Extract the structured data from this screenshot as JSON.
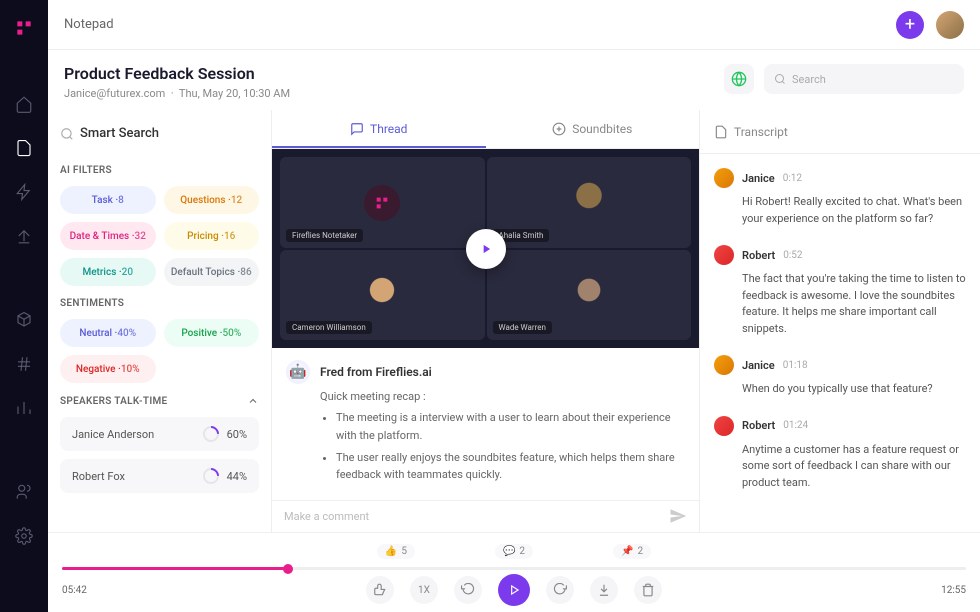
{
  "topbar": {
    "title": "Notepad"
  },
  "header": {
    "title": "Product Feedback Session",
    "email": "Janice@futurex.com",
    "date": "Thu, May 20, 10:30 AM",
    "search_placeholder": "Search"
  },
  "sidebar": {
    "smart_search": "Smart Search",
    "filters_label": "AI FILTERS",
    "filters": [
      [
        {
          "label": "Task",
          "count": 8,
          "cls": "p-blue"
        },
        {
          "label": "Questions",
          "count": 12,
          "cls": "p-orange"
        }
      ],
      [
        {
          "label": "Date & Times",
          "count": 32,
          "cls": "p-pink"
        },
        {
          "label": "Pricing",
          "count": 16,
          "cls": "p-yellow"
        }
      ],
      [
        {
          "label": "Metrics",
          "count": 20,
          "cls": "p-teal"
        },
        {
          "label": "Default Topics",
          "count": 86,
          "cls": "p-gray"
        }
      ]
    ],
    "sentiments_label": "SENTIMENTS",
    "sentiments": [
      [
        {
          "label": "Neutral",
          "count": "40%",
          "cls": "p-blue"
        },
        {
          "label": "Positive",
          "count": "50%",
          "cls": "p-green"
        }
      ],
      [
        {
          "label": "Negative",
          "count": "10%",
          "cls": "p-red"
        }
      ]
    ],
    "speakers_label": "SPEAKERS TALK-TIME",
    "speakers": [
      {
        "name": "Janice Anderson",
        "pct": "60%"
      },
      {
        "name": "Robert Fox",
        "pct": "44%"
      }
    ]
  },
  "tabs": {
    "thread": "Thread",
    "soundbites": "Soundbites"
  },
  "video_tiles": [
    "Fireflies Notetaker",
    "Ahalia Smith",
    "Cameron Williamson",
    "Wade Warren"
  ],
  "recap": {
    "author": "Fred from Fireflies.ai",
    "subtitle": "Quick meeting recap :",
    "bullets": [
      "The meeting is a interview with a user to learn about their experience with the platform.",
      "The user really enjoys the soundbites feature, which helps them share feedback with teammates quickly."
    ]
  },
  "comment_placeholder": "Make a comment",
  "transcript": {
    "label": "Transcript",
    "msgs": [
      {
        "name": "Janice",
        "time": "0:12",
        "text": "Hi Robert! Really excited to chat. What's been your experience on the platform so far?",
        "av": "av-j"
      },
      {
        "name": "Robert",
        "time": "0:52",
        "text": "The fact that you're taking the time to listen to feedback is awesome. I love the soundbites feature. It helps me share important call snippets.",
        "av": "av-r"
      },
      {
        "name": "Janice",
        "time": "01:18",
        "text": "When do you typically use that feature?",
        "av": "av-j"
      },
      {
        "name": "Robert",
        "time": "01:24",
        "text": "Anytime a customer has a feature request or some sort of feedback I can share with our product team.",
        "av": "av-r"
      }
    ]
  },
  "footer": {
    "like_count": "5",
    "comment_count": "2",
    "pin_count": "2",
    "time_current": "05:42",
    "time_total": "12:55",
    "speed": "1X"
  }
}
